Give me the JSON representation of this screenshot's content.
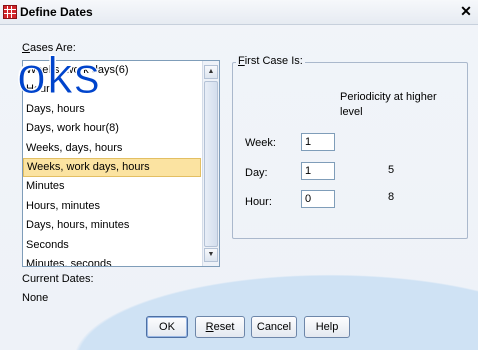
{
  "window": {
    "title": "Define Dates",
    "close_glyph": "✕"
  },
  "cases_are_label": "Cases Are:",
  "cases_list": {
    "items": [
      "Weeks, work days(6)",
      "Hours",
      "Days, hours",
      "Days, work hour(8)",
      "Weeks, days, hours",
      "Weeks, work days, hours",
      "Minutes",
      "Hours, minutes",
      "Days, hours, minutes",
      "Seconds",
      "Minutes, seconds"
    ],
    "selected": "Weeks, work days, hours"
  },
  "first_case": {
    "legend": "First Case Is:",
    "periodicity_header": "Periodicity at higher level",
    "fields": [
      {
        "label": "Week:",
        "value": "1",
        "periodicity": ""
      },
      {
        "label": "Day:",
        "value": "1",
        "periodicity": "5"
      },
      {
        "label": "Hour:",
        "value": "0",
        "periodicity": "8"
      }
    ]
  },
  "current_dates": {
    "label": "Current Dates:",
    "value": "None"
  },
  "buttons": {
    "ok": "OK",
    "reset": "Reset",
    "cancel": "Cancel",
    "help": "Help"
  },
  "watermark": "oks",
  "colors": {
    "selected_row": "#fbe3a1",
    "watermark": "#0044cc",
    "app_icon": "#d2262b"
  }
}
